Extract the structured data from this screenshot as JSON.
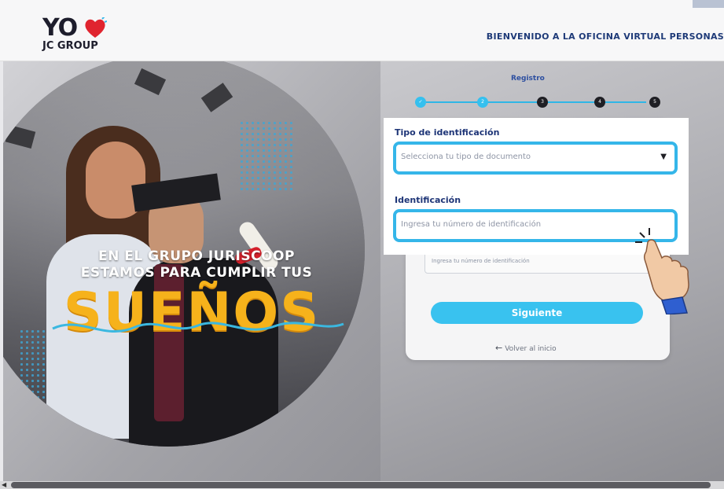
{
  "header": {
    "logo_main": "YO",
    "logo_sub": "JC GROUP",
    "welcome": "BIENVENIDO A LA OFICINA VIRTUAL PERSONAS"
  },
  "hero": {
    "slogan_line1": "EN EL GRUPO JURISCOOP",
    "slogan_line2": "ESTAMOS PARA CUMPLIR TUS",
    "big_word": "SUEÑOS"
  },
  "registration": {
    "title": "Registro",
    "steps": [
      {
        "label": "✓",
        "state": "done"
      },
      {
        "label": "2",
        "state": "current"
      },
      {
        "label": "3",
        "state": "pending"
      },
      {
        "label": "4",
        "state": "pending"
      },
      {
        "label": "5",
        "state": "pending"
      }
    ],
    "id_type": {
      "label": "Tipo de identificación",
      "placeholder": "Selecciona tu tipo de documento"
    },
    "id_number": {
      "label": "Identificación",
      "placeholder": "Ingresa tu número de identificación"
    },
    "ghost_placeholder": "Ingresa tu número de identificación",
    "next_button": "Siguiente",
    "back_link": "Volver al inicio"
  },
  "colors": {
    "accent": "#35b6e9",
    "brand_blue": "#1e3577",
    "brand_yellow": "#f6b21b",
    "brand_red": "#e0242f"
  }
}
